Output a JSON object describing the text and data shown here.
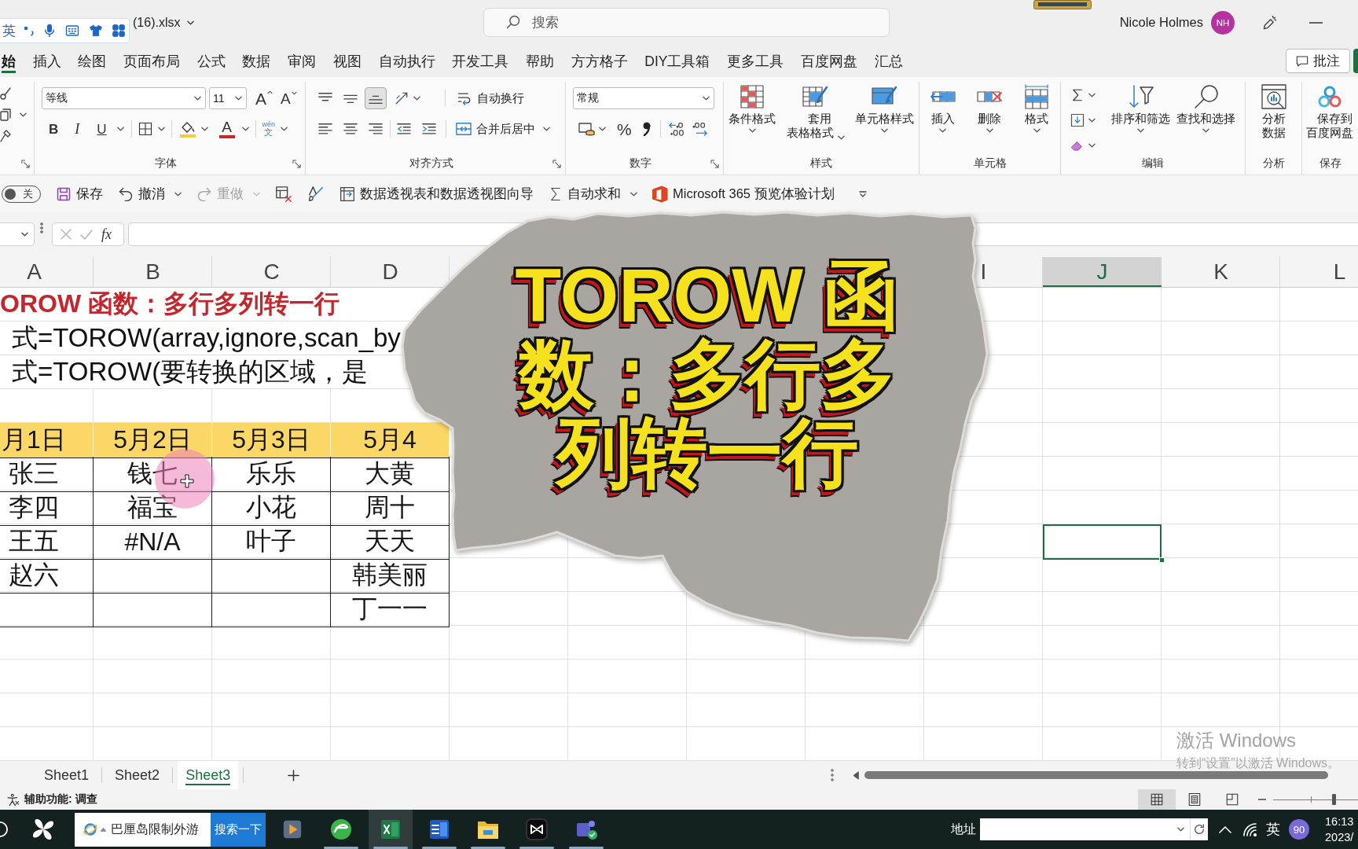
{
  "ime_toolbar": {
    "mode": "英"
  },
  "title_bar": {
    "file_name": "(16).xlsx",
    "search": {
      "placeholder": "搜索"
    },
    "user": {
      "name": "Nicole Holmes",
      "initials": "NH"
    }
  },
  "ribbon_tabs": [
    {
      "label": "始",
      "selected": true
    },
    {
      "label": "插入",
      "selected": false
    },
    {
      "label": "绘图",
      "selected": false
    },
    {
      "label": "页面布局",
      "selected": false
    },
    {
      "label": "公式",
      "selected": false
    },
    {
      "label": "数据",
      "selected": false
    },
    {
      "label": "审阅",
      "selected": false
    },
    {
      "label": "视图",
      "selected": false
    },
    {
      "label": "自动执行",
      "selected": false
    },
    {
      "label": "开发工具",
      "selected": false
    },
    {
      "label": "帮助",
      "selected": false
    },
    {
      "label": "方方格子",
      "selected": false
    },
    {
      "label": "DIY工具箱",
      "selected": false
    },
    {
      "label": "更多工具",
      "selected": false
    },
    {
      "label": "百度网盘",
      "selected": false
    },
    {
      "label": "汇总",
      "selected": false
    }
  ],
  "comments_button": {
    "label": "批注"
  },
  "ribbon": {
    "groups": [
      {
        "kind": "clipboard"
      },
      {
        "kind": "font",
        "label": "字体",
        "font_name": "等线",
        "font_size": "11",
        "grow": "A",
        "shrink": "A",
        "bold": "B",
        "italic": "I",
        "underline": "U",
        "font_color": "A",
        "phonetic": {
          "top": "wén",
          "bottom": "文"
        }
      },
      {
        "kind": "alignment",
        "label": "对齐方式",
        "vertical": [
          {
            "selected": false
          },
          {
            "selected": false
          },
          {
            "selected": true
          }
        ],
        "horizontal": [
          {
            "selected": false
          },
          {
            "selected": false
          },
          {
            "selected": false
          }
        ],
        "wrap": "自动换行",
        "merge": "合并后居中"
      },
      {
        "kind": "number",
        "label": "数字",
        "format": "常规",
        "percent": "%"
      },
      {
        "kind": "buttons",
        "label": "样式",
        "buttons": [
          {
            "kind": "conditional",
            "label": "条件格式"
          },
          {
            "kind": "table_format",
            "label": "套用表格格式"
          },
          {
            "kind": "cell_styles",
            "label": "单元格样式"
          }
        ]
      },
      {
        "kind": "buttons",
        "label": "单元格",
        "buttons": [
          {
            "kind": "insert",
            "label": "插入"
          },
          {
            "kind": "delete",
            "label": "删除"
          },
          {
            "kind": "format",
            "label": "格式"
          }
        ]
      },
      {
        "kind": "editing",
        "label": "编辑",
        "buttons": [
          {
            "kind": "sort",
            "label": "排序和筛选"
          },
          {
            "kind": "find",
            "label": "查找和选择"
          }
        ]
      },
      {
        "kind": "buttons",
        "label": "分析",
        "buttons": [
          {
            "kind": "analyze",
            "label": "分析数据"
          }
        ]
      },
      {
        "kind": "buttons",
        "label": "保存",
        "buttons": [
          {
            "kind": "cloud_save",
            "label": "保存到百度网盘"
          }
        ]
      }
    ]
  },
  "quick_access": {
    "autosave": {
      "label": "关",
      "on": false
    },
    "items": [
      {
        "kind": "save",
        "label": "保存",
        "disabled": false
      },
      {
        "kind": "undo",
        "label": "撤消",
        "disabled": false
      },
      {
        "kind": "redo",
        "label": "重做",
        "disabled": true
      },
      {
        "kind": "clear",
        "disabled": false
      },
      {
        "kind": "brush",
        "disabled": false
      },
      {
        "kind": "pivot",
        "label": "数据透视表和数据透视图向导",
        "disabled": false
      },
      {
        "kind": "autosum",
        "label": "自动求和",
        "disabled": false
      },
      {
        "kind": "preview",
        "label": "Microsoft 365 预览体验计划",
        "disabled": false
      }
    ]
  },
  "formula_bar": {
    "function_label": "fx"
  },
  "sheet": {
    "columns": [
      {
        "label": "A",
        "selected": false
      },
      {
        "label": "B",
        "selected": false
      },
      {
        "label": "C",
        "selected": false
      },
      {
        "label": "D",
        "selected": false
      },
      {
        "label": "I",
        "selected": false
      },
      {
        "label": "J",
        "selected": true
      },
      {
        "label": "K",
        "selected": false
      },
      {
        "label": "L",
        "selected": false
      }
    ],
    "rows": [
      {
        "kind": "title",
        "selected": false,
        "text": "OROW 函数：多行多列转一行"
      },
      {
        "kind": "note",
        "selected": false,
        "text": "式=TOROW(array,ignore,scan_by"
      },
      {
        "kind": "note",
        "selected": false,
        "text": "式=TOROW(要转换的区域，是"
      },
      {
        "kind": "table_header",
        "selected": false,
        "cells": [
          "月1日",
          "5月2日",
          "5月3日",
          "5月4"
        ]
      },
      {
        "kind": "table_row",
        "selected": false,
        "cells": [
          "张三",
          "钱七",
          "乐乐",
          "大黄"
        ]
      },
      {
        "kind": "table_row",
        "selected": false,
        "cells": [
          "李四",
          "福宝",
          "小花",
          "周十"
        ]
      },
      {
        "kind": "table_row",
        "selected": true,
        "cells": [
          "王五",
          "#N/A",
          "叶子",
          "天天"
        ]
      },
      {
        "kind": "table_row",
        "selected": false,
        "cells": [
          "赵六",
          null,
          null,
          "韩美丽"
        ]
      },
      {
        "kind": "table_row",
        "selected": false,
        "cells": [
          null,
          null,
          null,
          "丁一一"
        ]
      }
    ]
  },
  "title_card": {
    "text": "TOROW 函数：多行多列转一行"
  },
  "activation_notice": {
    "title": "激活 Windows",
    "hint": "转到“设置”以激活 Windows。"
  },
  "sheet_tabs": [
    {
      "label": "Sheet1",
      "selected": false
    },
    {
      "label": "Sheet2",
      "selected": false
    },
    {
      "label": "Sheet3",
      "selected": true
    }
  ],
  "status_bar": {
    "accessibility": "辅助功能: 调查",
    "views": [
      {
        "kind": "normal",
        "selected": true
      },
      {
        "kind": "page_layout",
        "selected": false
      },
      {
        "kind": "page_break",
        "selected": false
      }
    ],
    "zoom": {
      "level": 0.71
    }
  },
  "taskbar": {
    "search": {
      "value": "巴厘岛限制外游",
      "button": "搜索一下"
    },
    "apps": [
      {
        "kind": "player",
        "active": false,
        "running": false
      },
      {
        "kind": "browser",
        "active": false,
        "running": true
      },
      {
        "kind": "spreadsheet",
        "active": true,
        "running": true
      },
      {
        "kind": "document",
        "active": false,
        "running": true
      },
      {
        "kind": "files",
        "active": false,
        "running": true
      },
      {
        "kind": "editor",
        "active": false,
        "running": true
      },
      {
        "kind": "chat",
        "active": false,
        "running": true
      }
    ],
    "address": {
      "label": "地址"
    },
    "ime": "英",
    "badge": "90",
    "time": "16:13",
    "date": "2023/"
  }
}
